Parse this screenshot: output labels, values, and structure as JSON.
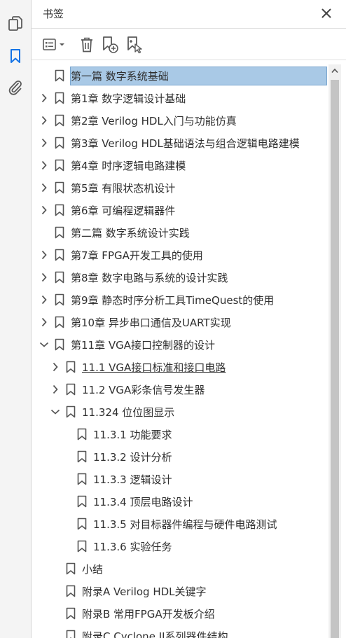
{
  "panel": {
    "title": "书签"
  },
  "rail": {
    "items": [
      {
        "name": "pages",
        "icon": "copy-pages-icon"
      },
      {
        "name": "bookmarks",
        "icon": "bookmark-icon",
        "active_color": "#1473e6"
      },
      {
        "name": "attachments",
        "icon": "paperclip-icon"
      }
    ]
  },
  "toolbar": {
    "items": [
      "options-menu-icon",
      "delete-bookmark-icon",
      "new-bookmark-icon",
      "find-current-bookmark-icon"
    ]
  },
  "colors": {
    "selection": "#a9c9e6",
    "accent": "#1473e6"
  },
  "tree": {
    "rows": [
      {
        "label": "第一篇 数字系统基础",
        "level": 0,
        "chevron": "none",
        "selected": true
      },
      {
        "label": "第1章 数字逻辑设计基础",
        "level": 0,
        "chevron": "right"
      },
      {
        "label": "第2章 Verilog HDL入门与功能仿真",
        "level": 0,
        "chevron": "right"
      },
      {
        "label": "第3章 Verilog HDL基础语法与组合逻辑电路建模",
        "level": 0,
        "chevron": "right"
      },
      {
        "label": "第4章 时序逻辑电路建模",
        "level": 0,
        "chevron": "right"
      },
      {
        "label": "第5章 有限状态机设计",
        "level": 0,
        "chevron": "right"
      },
      {
        "label": "第6章 可编程逻辑器件",
        "level": 0,
        "chevron": "right"
      },
      {
        "label": "第二篇 数字系统设计实践",
        "level": 0,
        "chevron": "none"
      },
      {
        "label": "第7章 FPGA开发工具的使用",
        "level": 0,
        "chevron": "right"
      },
      {
        "label": "第8章 数字电路与系统的设计实践",
        "level": 0,
        "chevron": "right"
      },
      {
        "label": "第9章 静态时序分析工具TimeQuest的使用",
        "level": 0,
        "chevron": "right"
      },
      {
        "label": "第10章 异步串口通信及UART实现",
        "level": 0,
        "chevron": "right"
      },
      {
        "label": "第11章 VGA接口控制器的设计",
        "level": 0,
        "chevron": "down"
      },
      {
        "label": "11.1 VGA接口标准和接口电路",
        "level": 1,
        "chevron": "right",
        "underline": true
      },
      {
        "label": "11.2 VGA彩条信号发生器",
        "level": 1,
        "chevron": "right"
      },
      {
        "label": "11.324 位位图显示",
        "level": 1,
        "chevron": "down"
      },
      {
        "label": "11.3.1 功能要求",
        "level": 2,
        "chevron": "none"
      },
      {
        "label": "11.3.2 设计分析",
        "level": 2,
        "chevron": "none"
      },
      {
        "label": "11.3.3 逻辑设计",
        "level": 2,
        "chevron": "none"
      },
      {
        "label": "11.3.4 顶层电路设计",
        "level": 2,
        "chevron": "none"
      },
      {
        "label": "11.3.5 对目标器件编程与硬件电路测试",
        "level": 2,
        "chevron": "none"
      },
      {
        "label": "11.3.6 实验任务",
        "level": 2,
        "chevron": "none"
      },
      {
        "label": "小结",
        "level": 1,
        "chevron": "none"
      },
      {
        "label": "附录A  Verilog HDL关键字",
        "level": 1,
        "chevron": "none"
      },
      {
        "label": "附录B  常用FPGA开发板介绍",
        "level": 1,
        "chevron": "none"
      },
      {
        "label": "附录C  Cyclone II系列器件结构",
        "level": 1,
        "chevron": "none"
      }
    ]
  }
}
